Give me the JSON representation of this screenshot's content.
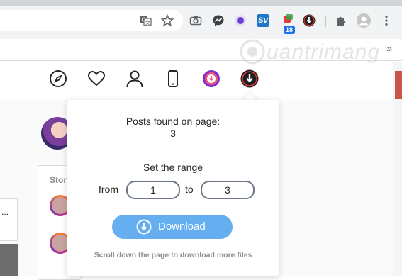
{
  "browser": {
    "toolbar_icons": [
      "translate-icon",
      "star-icon",
      "camera-icon",
      "messenger-icon",
      "purple-extension-icon",
      "sv-extension-icon",
      "tip-badge-extension-icon",
      "download-extension-icon",
      "puzzle-icon",
      "profile-icon",
      "menu-icon"
    ],
    "badge_count": "18",
    "sv_label": "Sv",
    "bookmark_more": "»"
  },
  "watermark": {
    "text": "uantrimang"
  },
  "instagram": {
    "nav_icons": [
      "explore-icon",
      "heart-icon",
      "profile-icon",
      "phone-icon",
      "downloader-ext-icon",
      "download-ext-icon"
    ],
    "stories_label": "Stor",
    "more_dots": "..."
  },
  "popup": {
    "posts_label": "Posts found on page:",
    "posts_count": "3",
    "range_label": "Set the range",
    "from_label": "from",
    "from_value": "1",
    "to_label": "to",
    "to_value": "3",
    "download_label": "Download",
    "hint": "Scroll down the page to download more files"
  },
  "colors": {
    "accent_button": "#65aef0",
    "input_border": "#6b7785"
  }
}
